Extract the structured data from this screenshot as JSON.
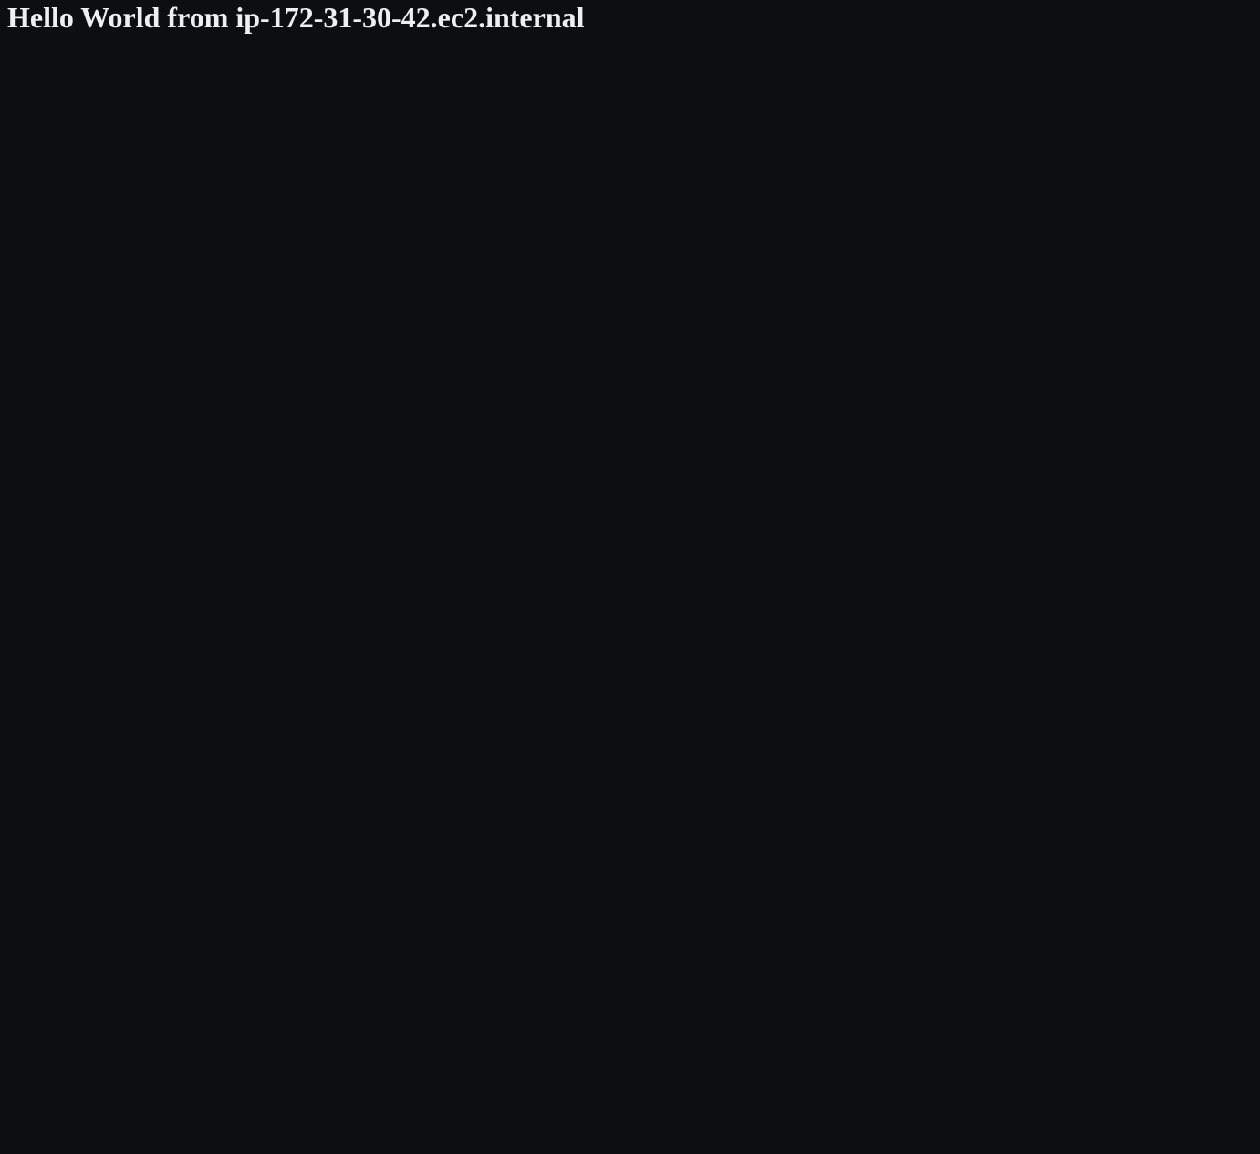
{
  "page": {
    "heading": "Hello World from ip-172-31-30-42.ec2.internal"
  }
}
